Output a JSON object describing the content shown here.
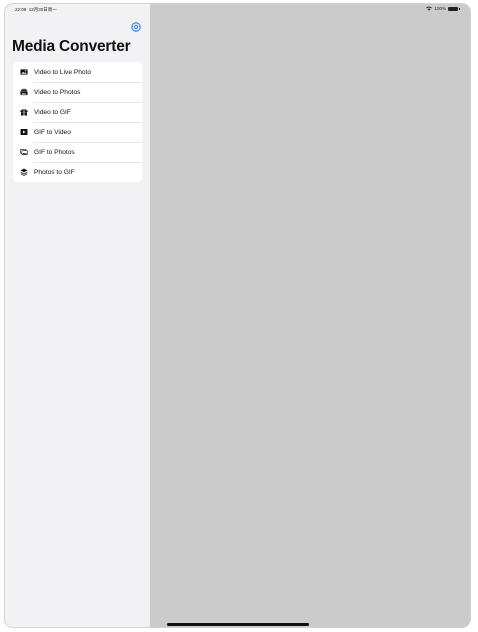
{
  "status_bar": {
    "time": "22:09",
    "date": "12月30日周一",
    "battery": "100%",
    "wifi_icon": "wifi-icon",
    "battery_icon": "battery-icon"
  },
  "header": {
    "settings_icon": "gear-icon",
    "title": "Media Converter"
  },
  "menu": {
    "items": [
      {
        "label": "Video to Live Photo",
        "icon": "photo-icon"
      },
      {
        "label": "Video to Photos",
        "icon": "photo-stack-icon"
      },
      {
        "label": "Video to GIF",
        "icon": "gift-icon"
      },
      {
        "label": "GIF to Video",
        "icon": "play-rectangle-icon"
      },
      {
        "label": "GIF to Photos",
        "icon": "photos-icon"
      },
      {
        "label": "Photos to GIF",
        "icon": "stack-icon"
      }
    ]
  },
  "colors": {
    "accent": "#2f7fe6",
    "sidebar_bg": "#f2f2f4",
    "detail_bg": "#cbcbcb"
  }
}
